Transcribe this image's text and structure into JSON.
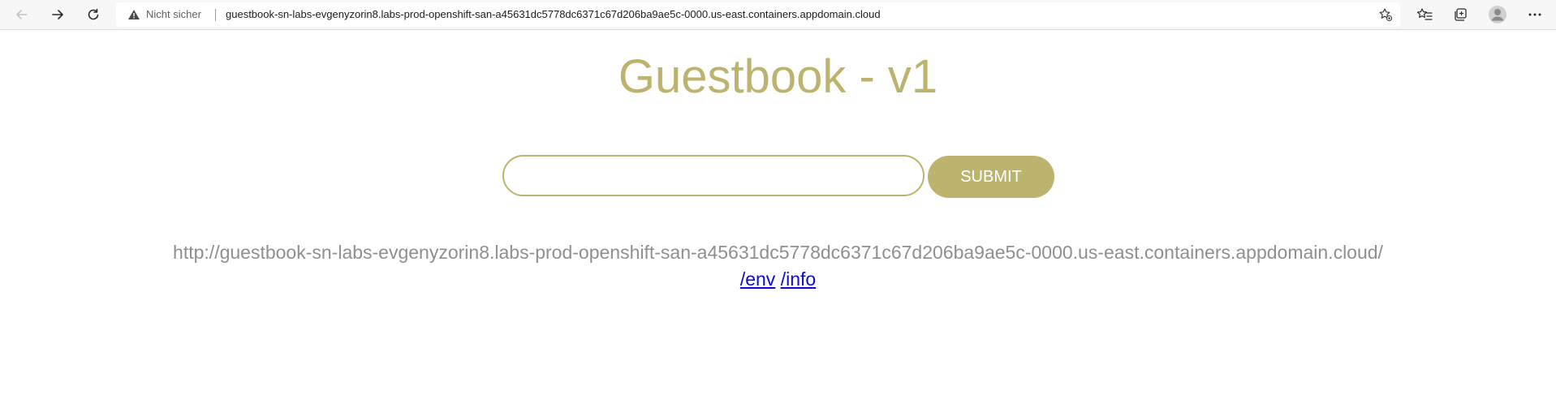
{
  "browser": {
    "security_label": "Nicht sicher",
    "url": "guestbook-sn-labs-evgenyzorin8.labs-prod-openshift-san-a45631dc5778dc6371c67d206ba9ae5c-0000.us-east.containers.appdomain.cloud",
    "icons": [
      "back-arrow-icon",
      "forward-arrow-icon",
      "reload-icon",
      "warning-icon",
      "add-favorite-icon",
      "favorites-icon",
      "collections-icon",
      "profile-icon",
      "more-icon"
    ]
  },
  "page": {
    "title": "Guestbook - v1",
    "input_value": "",
    "submit_label": "SUBMIT",
    "host_url": "http://guestbook-sn-labs-evgenyzorin8.labs-prod-openshift-san-a45631dc5778dc6371c67d206ba9ae5c-0000.us-east.containers.appdomain.cloud/",
    "links": {
      "env": "/env",
      "info": "/info"
    }
  },
  "colors": {
    "accent": "#bcb46e",
    "muted_text": "#8f8f8f",
    "link": "#0b0bd6"
  }
}
